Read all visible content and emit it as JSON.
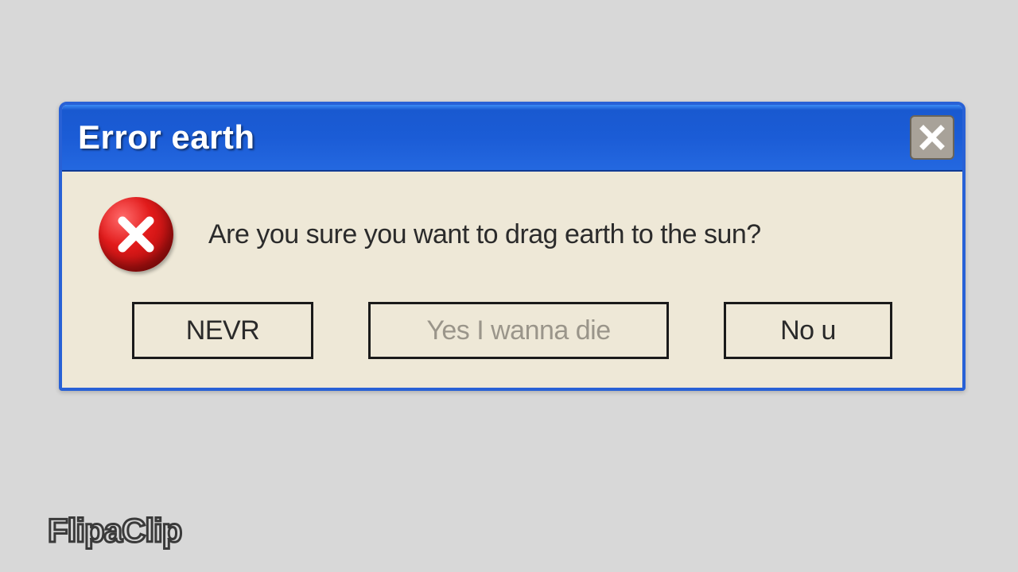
{
  "dialog": {
    "title": "Error earth",
    "message": "Are you sure you want to drag earth to the sun?",
    "buttons": {
      "nevr": "NEVR",
      "yes": "Yes I wanna die",
      "nou": "No u"
    }
  },
  "watermark": "FlipaClip"
}
